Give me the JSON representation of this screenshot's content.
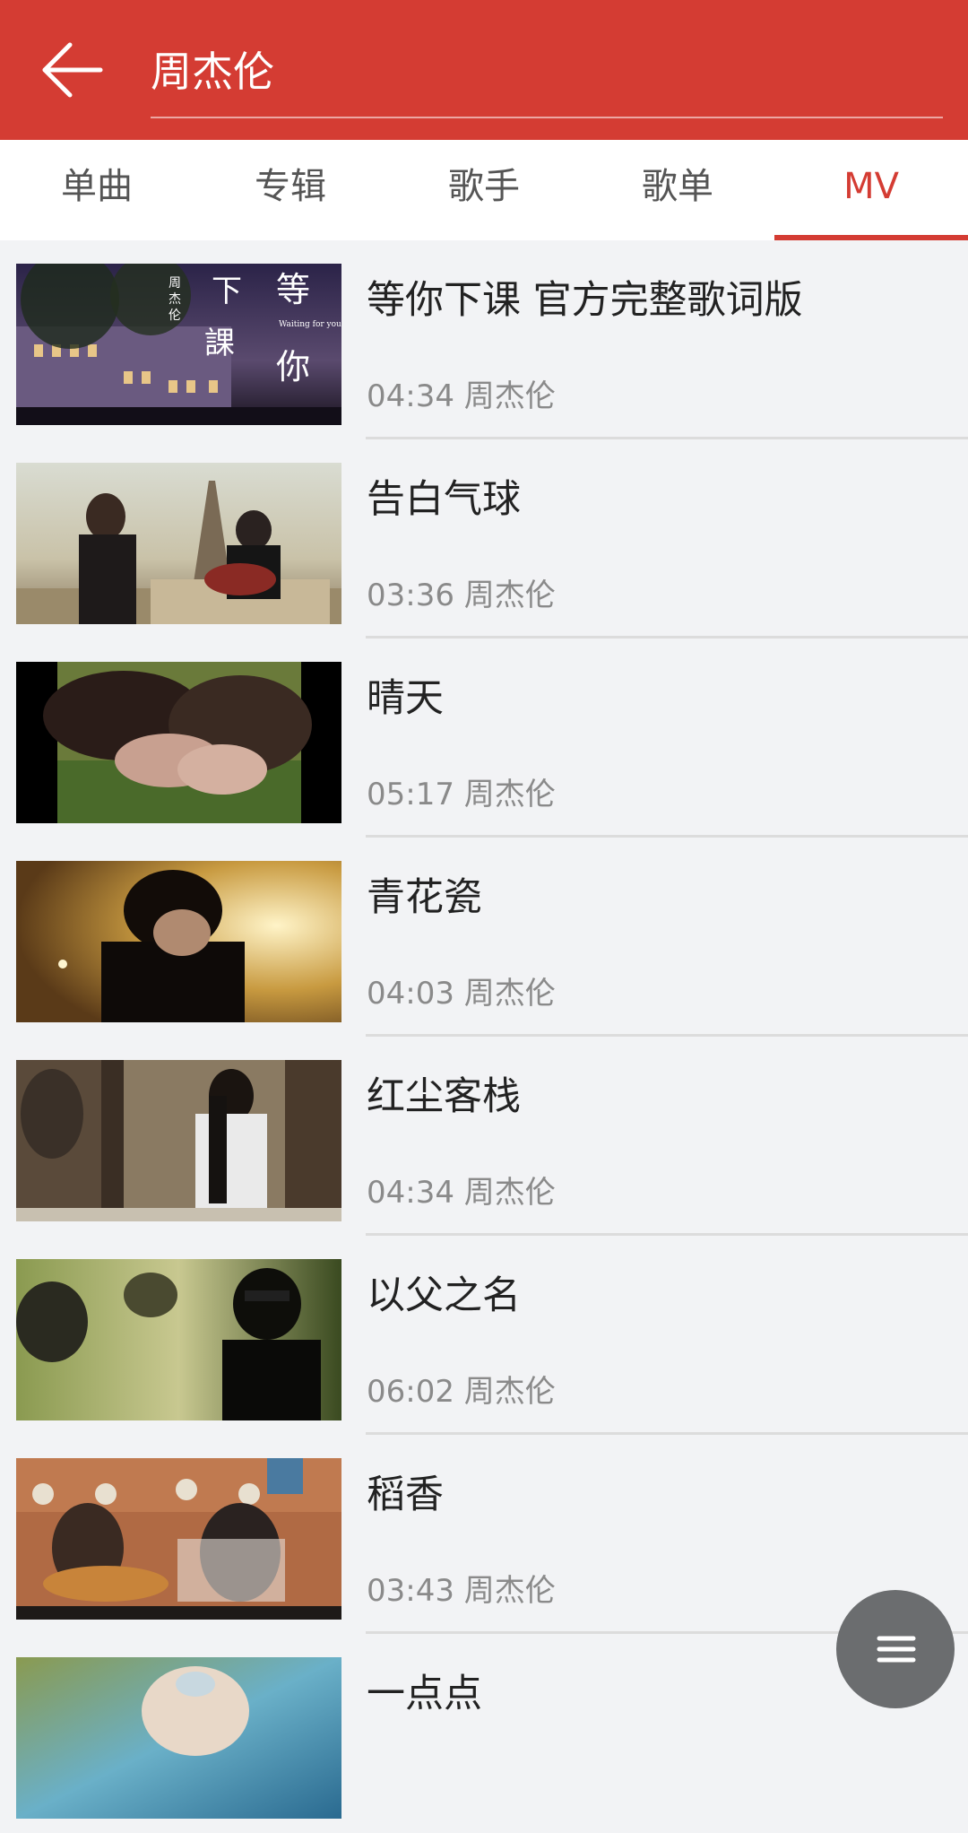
{
  "search": {
    "query": "周杰伦"
  },
  "tabs": [
    {
      "label": "单曲"
    },
    {
      "label": "专辑"
    },
    {
      "label": "歌手"
    },
    {
      "label": "歌单"
    },
    {
      "label": "MV"
    }
  ],
  "active_tab": "MV",
  "mv_list": [
    {
      "title": "等你下课 官方完整歌词版",
      "duration": "04:34",
      "artist": "周杰伦",
      "meta": "04:34 周杰伦"
    },
    {
      "title": "告白气球",
      "duration": "03:36",
      "artist": "周杰伦",
      "meta": "03:36 周杰伦"
    },
    {
      "title": "晴天",
      "duration": "05:17",
      "artist": "周杰伦",
      "meta": "05:17 周杰伦"
    },
    {
      "title": "青花瓷",
      "duration": "04:03",
      "artist": "周杰伦",
      "meta": "04:03 周杰伦"
    },
    {
      "title": "红尘客栈",
      "duration": "04:34",
      "artist": "周杰伦",
      "meta": "04:34 周杰伦"
    },
    {
      "title": "以父之名",
      "duration": "06:02",
      "artist": "周杰伦",
      "meta": "06:02 周杰伦"
    },
    {
      "title": "稻香",
      "duration": "03:43",
      "artist": "周杰伦",
      "meta": "03:43 周杰伦"
    },
    {
      "title": "一点点",
      "duration": "",
      "artist": "",
      "meta": ""
    }
  ],
  "thumb1_text": {
    "line1": "下",
    "line2": "課",
    "line3": "等",
    "line4": "你",
    "small": "周杰伦",
    "en": "Waiting for you"
  },
  "colors": {
    "primary": "#d43c33",
    "background": "#f2f3f5",
    "title": "#222222",
    "meta": "#8a8a8a",
    "tab_text": "#555555",
    "fab": "#6b6d6f"
  },
  "icons": {
    "back": "arrow-left-icon",
    "menu": "menu-icon"
  }
}
